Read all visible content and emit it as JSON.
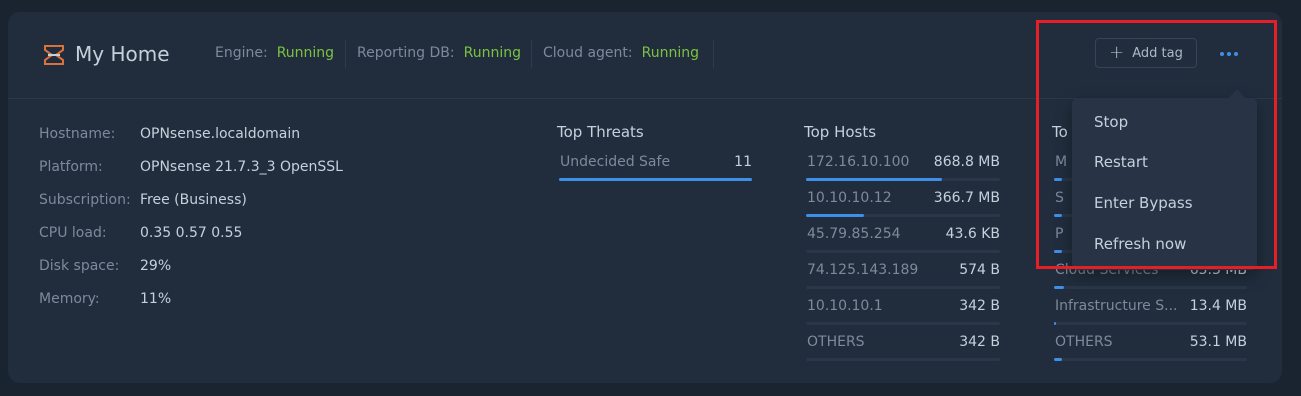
{
  "header": {
    "title": "My Home",
    "statuses": [
      {
        "label": "Engine:",
        "value": "Running"
      },
      {
        "label": "Reporting DB:",
        "value": "Running"
      },
      {
        "label": "Cloud agent:",
        "value": "Running"
      }
    ],
    "add_tag_label": "Add tag"
  },
  "colors": {
    "card_bg": "#212d3d",
    "page_bg": "#1a2431",
    "status_running": "#7cc241",
    "accent_blue": "#3e8fe8",
    "highlight_red": "#e41f25"
  },
  "icons": [
    "sensei-logo-icon",
    "plus-icon",
    "more-dots-icon"
  ],
  "info": [
    {
      "key": "Hostname:",
      "value": "OPNsense.localdomain"
    },
    {
      "key": "Platform:",
      "value": "OPNsense 21.7.3_3 OpenSSL"
    },
    {
      "key": "Subscription:",
      "value": "Free  (Business)"
    },
    {
      "key": "CPU load:",
      "value": "0.35 0.57 0.55"
    },
    {
      "key": "Disk space:",
      "value": "29%"
    },
    {
      "key": "Memory:",
      "value": "11%"
    }
  ],
  "top_threats": {
    "title": "Top Threats",
    "items": [
      {
        "name": "Undecided Safe",
        "value": "11",
        "fill": 1.0
      }
    ]
  },
  "top_hosts": {
    "title": "Top Hosts",
    "items": [
      {
        "name": "172.16.10.100",
        "value": "868.8 MB",
        "fill": 0.7
      },
      {
        "name": "10.10.10.12",
        "value": "366.7 MB",
        "fill": 0.3
      },
      {
        "name": "45.79.85.254",
        "value": "43.6 KB",
        "fill": 0.0
      },
      {
        "name": "74.125.143.189",
        "value": "574 B",
        "fill": 0.0
      },
      {
        "name": "10.10.10.1",
        "value": "342 B",
        "fill": 0.0
      },
      {
        "name": "OTHERS",
        "value": "342 B",
        "fill": 0.0
      }
    ]
  },
  "top_categories": {
    "title_visible": "To",
    "items": [
      {
        "name": "M",
        "value": "",
        "fill": 0.04
      },
      {
        "name": "S",
        "value": "",
        "fill": 0.04
      },
      {
        "name": "P",
        "value": "",
        "fill": 0.04
      },
      {
        "name": "Cloud Services",
        "value": "65.3 MB",
        "fill": 0.05
      },
      {
        "name": "Infrastructure S...",
        "value": "13.4 MB",
        "fill": 0.01
      },
      {
        "name": "OTHERS",
        "value": "53.1 MB",
        "fill": 0.04
      }
    ]
  },
  "dropdown": {
    "items": [
      "Stop",
      "Restart",
      "Enter Bypass",
      "Refresh now"
    ]
  }
}
